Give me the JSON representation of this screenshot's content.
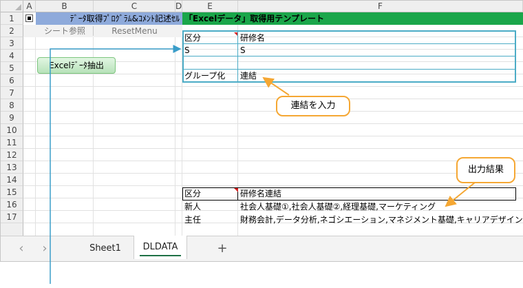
{
  "columns": [
    "A",
    "B",
    "C",
    "D",
    "E",
    "F"
  ],
  "rows": [
    "1",
    "2",
    "3",
    "4",
    "5",
    "6",
    "7",
    "8",
    "9",
    "10",
    "11",
    "12",
    "13",
    "14",
    "15",
    "16",
    "17"
  ],
  "header_band": {
    "left_text": "ﾃﾞｰﾀ取得ﾌﾟﾛｸﾞﾗﾑ&ｺﾒﾝﾄ記述ｾﾙ",
    "right_text": "「Excelデータ」取得用テンプレート",
    "left_color": "#8eaadb",
    "right_color": "#1aa64a"
  },
  "row2": {
    "sheet_ref": "シート参照",
    "reset_menu": "ResetMenu"
  },
  "button": {
    "label": "Excelﾃﾞｰﾀ抽出",
    "color": "#c6efce"
  },
  "template": {
    "header": {
      "col_e": "区分",
      "col_f": "研修名"
    },
    "row3": {
      "col_e": "S",
      "col_f": "S"
    },
    "row5": {
      "col_e": "グループ化",
      "col_f": "連結"
    }
  },
  "output": {
    "header": {
      "col_e": "区分",
      "col_f": "研修名連結"
    },
    "rows": [
      {
        "col_e": "新人",
        "col_f": "社会人基礎①,社会人基礎②,経理基礎,マーケティング"
      },
      {
        "col_e": "主任",
        "col_f": "財務会計,データ分析,ネゴシエーション,マネジメント基礎,キャリアデザイン"
      }
    ]
  },
  "callouts": {
    "concat": "連結を入力",
    "output": "出力結果"
  },
  "sheet_tabs": {
    "sheet1": "Sheet1",
    "dldata": "DLDATA",
    "add": "+"
  },
  "nav": {
    "prev": "‹",
    "next": "›"
  },
  "icons": {
    "corner": "select-all-triangle",
    "checkbox": "black-square-icon"
  },
  "accent_colors": {
    "callout_border": "#f5a733",
    "arrow": "#3a9dc9",
    "frame": "#4bacc6"
  }
}
